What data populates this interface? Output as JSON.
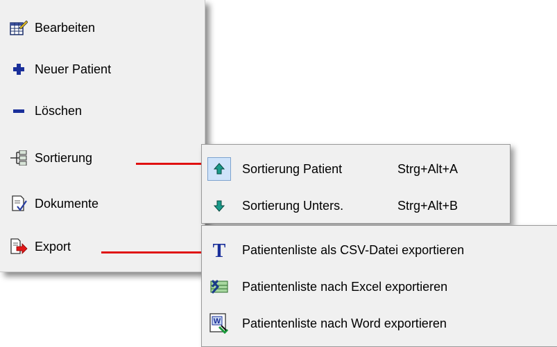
{
  "main_menu": {
    "items": [
      {
        "label": "Bearbeiten",
        "icon": "edit-table-icon"
      },
      {
        "label": "Neuer Patient",
        "icon": "plus-icon"
      },
      {
        "label": "Löschen",
        "icon": "minus-icon"
      },
      {
        "label": "Sortierung",
        "icon": "sort-tree-icon"
      },
      {
        "label": "Dokumente",
        "icon": "document-check-icon"
      },
      {
        "label": "Export",
        "icon": "export-arrow-icon"
      }
    ]
  },
  "sort_submenu": {
    "items": [
      {
        "label": "Sortierung Patient",
        "shortcut": "Strg+Alt+A",
        "icon": "arrow-up-icon"
      },
      {
        "label": "Sortierung Unters.",
        "shortcut": "Strg+Alt+B",
        "icon": "arrow-down-icon"
      }
    ]
  },
  "export_submenu": {
    "items": [
      {
        "label": "Patientenliste als CSV-Datei exportieren",
        "icon": "text-t-icon"
      },
      {
        "label": "Patientenliste nach Excel exportieren",
        "icon": "excel-icon"
      },
      {
        "label": "Patientenliste nach Word exportieren",
        "icon": "word-icon"
      }
    ]
  },
  "colors": {
    "menu_bg": "#f0f0f0",
    "connector": "#e01010",
    "selected_bg": "#cfe3fa",
    "icon_blue": "#1a2f9a",
    "icon_teal": "#1a9a8a"
  }
}
